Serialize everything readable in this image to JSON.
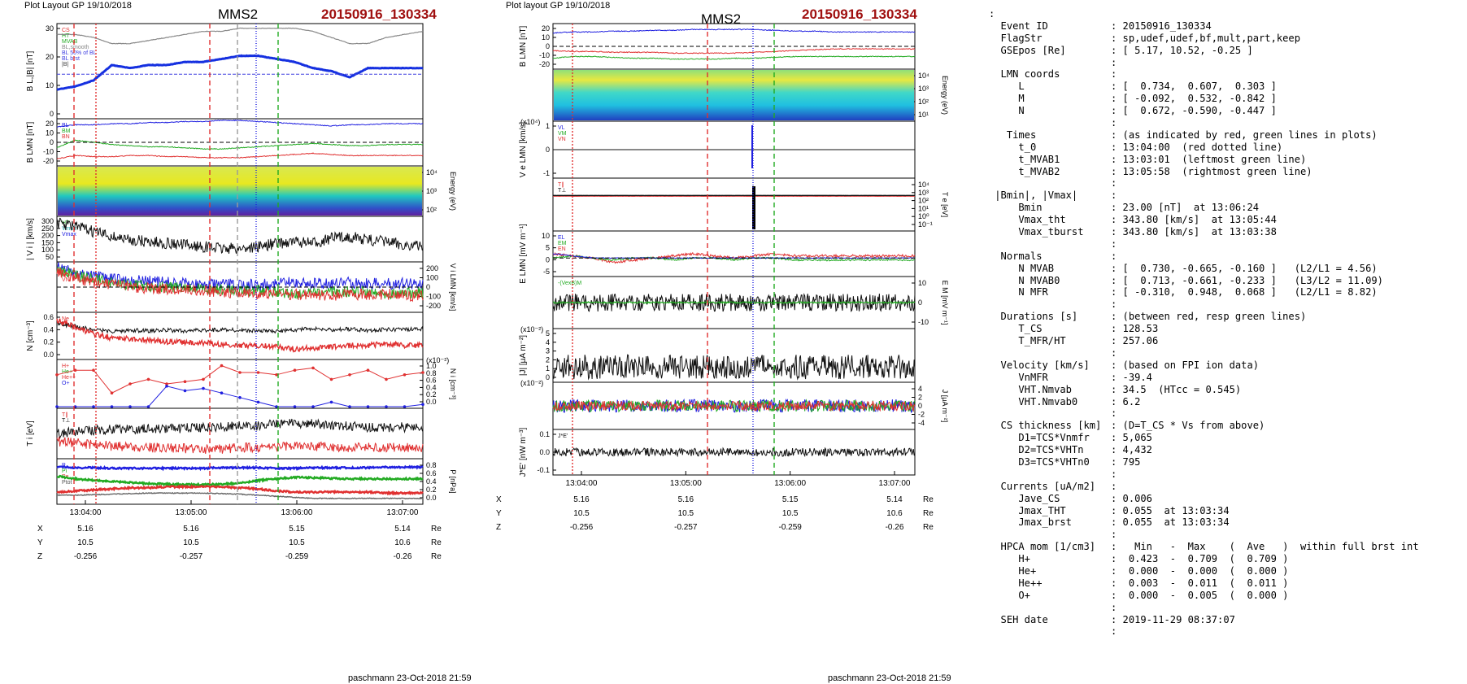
{
  "left": {
    "layout_label": "Plot Layout GP 19/10/2018",
    "title": "MMS2",
    "event": "20150916_130334",
    "footer": "paschmann 23-Oct-2018 21:59",
    "time_ticks": [
      "13:04:00",
      "13:05:00",
      "13:06:00",
      "13:07:00"
    ],
    "pos_rows": [
      {
        "label": "X",
        "vals": [
          "5.16",
          "5.16",
          "5.15",
          "5.14"
        ],
        "unit": "Re"
      },
      {
        "label": "Y",
        "vals": [
          "10.5",
          "10.5",
          "10.5",
          "10.6"
        ],
        "unit": "Re"
      },
      {
        "label": "Z",
        "vals": [
          "-0.256",
          "-0.257",
          "-0.259",
          "-0.26"
        ],
        "unit": "Re"
      }
    ],
    "panels": [
      {
        "ylabel": "B",
        "ylabel_sub": "L",
        "ylabel_rest": ",|B| [nT]",
        "yticks": [
          "30",
          "20",
          "10",
          "0"
        ],
        "legend": [
          "CS",
          "HT",
          "MVAB",
          "BL,smooth",
          "BL 50% of BL",
          "BL brst",
          "|B|"
        ],
        "legend_colors": [
          "#e03030",
          "#22aa22",
          "#22aa22",
          "#888888",
          "#4040e0",
          "#4040e0",
          "#444444"
        ]
      },
      {
        "ylabel": "B",
        "ylabel_sub": "LMN",
        "ylabel_rest": " [nT]",
        "yticks": [
          "20",
          "10",
          "0",
          "-10",
          "-20"
        ],
        "legend": [
          "BL",
          "BM",
          "BN"
        ],
        "legend_colors": [
          "#2020e0",
          "#22aa22",
          "#e03030"
        ]
      },
      {
        "ylabel": "",
        "ylabel_sub": "",
        "ylabel_rest": "",
        "yticks_right": [
          "10⁴",
          "10³",
          "10²"
        ],
        "right_label": "Energy (eV)"
      },
      {
        "ylabel": "| V",
        "ylabel_sub": "i",
        "ylabel_rest": " | [km/s]",
        "yticks": [
          "300",
          "250",
          "200",
          "150",
          "100",
          "50"
        ],
        "legend": [
          "HT",
          "Vmax",
          "Vmax"
        ],
        "legend_colors": [
          "#22aa22",
          "#22aaaa",
          "#2020e0"
        ]
      },
      {
        "ylabel": "",
        "yticks_right": [
          "200",
          "100",
          "0",
          "-100",
          "-200"
        ],
        "right_label": "V i LMN [km/s]",
        "legend": [
          "VL",
          "VM",
          "VN"
        ],
        "legend_colors": [
          "#2020e0",
          "#22aa22",
          "#e03030"
        ]
      },
      {
        "ylabel": "N [cm",
        "ylabel_sub": "",
        "ylabel_rest": "⁻³]",
        "yticks": [
          "0.6",
          "0.4",
          "0.2",
          "0.0"
        ],
        "legend": [
          "Ne",
          "Ni"
        ],
        "legend_colors": [
          "#e03030",
          "#111111"
        ]
      },
      {
        "ylabel": "",
        "yticks_right": [
          "1.0",
          "0.8",
          "0.6",
          "0.4",
          "0.2",
          "0.0"
        ],
        "right_label": "N i [cm⁻³]",
        "exp": "(x10⁻²)",
        "legend": [
          "H+",
          "He+",
          "He++",
          "O+"
        ],
        "legend_colors": [
          "#e03030",
          "#22aa22",
          "#e03030",
          "#2020e0"
        ]
      },
      {
        "ylabel": "T",
        "ylabel_sub": "i",
        "ylabel_rest": " [eV]",
        "yticks": [],
        "legend": [
          "T∥",
          "T⊥"
        ],
        "legend_colors": [
          "#e03030",
          "#111111"
        ]
      },
      {
        "ylabel": "",
        "yticks_right": [
          "0.8",
          "0.6",
          "0.4",
          "0.2",
          "0.0"
        ],
        "right_label": "P [nPa]",
        "legend": [
          "P",
          "Pi",
          "Pe",
          "Ptot"
        ],
        "legend_colors": [
          "#2020e0",
          "#22aa22",
          "#e03030",
          "#555555"
        ]
      }
    ]
  },
  "right": {
    "layout_label": "Plot layout GP 19/10/2018",
    "title": "MMS2",
    "event": "20150916_130334",
    "footer": "paschmann 23-Oct-2018 21:59",
    "time_ticks": [
      "13:04:00",
      "13:05:00",
      "13:06:00",
      "13:07:00"
    ],
    "pos_rows": [
      {
        "label": "X",
        "vals": [
          "5.16",
          "5.16",
          "5.15",
          "5.14"
        ],
        "unit": "Re"
      },
      {
        "label": "Y",
        "vals": [
          "10.5",
          "10.5",
          "10.5",
          "10.6"
        ],
        "unit": "Re"
      },
      {
        "label": "Z",
        "vals": [
          "-0.256",
          "-0.257",
          "-0.259",
          "-0.26"
        ],
        "unit": "Re"
      }
    ],
    "panels": [
      {
        "ylabel": "B LMN [nT]",
        "yticks": [
          "20",
          "10",
          "0",
          "-10",
          "-20"
        ]
      },
      {
        "ylabel": "",
        "right_label": "Energy (eV)",
        "yticks_right": [
          "10⁴",
          "10³",
          "10²",
          "10¹"
        ]
      },
      {
        "ylabel": "V e LMN [km/s]",
        "exp": "(x10⁴)",
        "yticks": [
          "1",
          "0",
          "-1"
        ],
        "legend": [
          "VL",
          "VM",
          "VN"
        ],
        "legend_colors": [
          "#2020e0",
          "#22aa22",
          "#e03030"
        ]
      },
      {
        "ylabel": "",
        "right_label": "T e [eV]",
        "yticks_right": [
          "10⁴",
          "10³",
          "10²",
          "10¹",
          "10⁰",
          "10⁻¹"
        ],
        "legend": [
          "T∥",
          "T⊥"
        ],
        "legend_colors": [
          "#e03030",
          "#111111"
        ]
      },
      {
        "ylabel": "E LMN [mV m⁻¹]",
        "yticks": [
          "10",
          "5",
          "0",
          "-5"
        ],
        "legend": [
          "EL",
          "EM",
          "EN"
        ],
        "legend_colors": [
          "#2020e0",
          "#22aa22",
          "#e03030"
        ]
      },
      {
        "ylabel": "",
        "right_label": "E M [mV m⁻¹]",
        "yticks_right": [
          "10",
          "0",
          "-10"
        ],
        "legend": [
          "-(VexB)M"
        ],
        "legend_colors": [
          "#22aa22"
        ]
      },
      {
        "ylabel": "|J| [μA m⁻²]",
        "exp": "(x10⁻²)",
        "yticks": [
          "5",
          "4",
          "3",
          "2",
          "1",
          "0"
        ]
      },
      {
        "ylabel": "",
        "right_label": "J [μA m⁻²]",
        "exp": "(x10⁻²)",
        "yticks_right": [
          "4",
          "2",
          "0",
          "-2",
          "-4"
        ]
      },
      {
        "ylabel": "J*E' [nW m⁻³]",
        "yticks": [
          "0.1",
          "0.0",
          "-0.1"
        ],
        "legend": [
          "J*E'"
        ],
        "legend_colors": [
          "#111111"
        ]
      }
    ]
  },
  "summary": [
    {
      "k": ":",
      "v": ""
    },
    {
      "k": "  Event ID",
      "v": ": 20150916_130334"
    },
    {
      "k": "  FlagStr",
      "v": ": sp,udef,udef,bf,mult,part,keep"
    },
    {
      "k": "  GSEpos [Re]",
      "v": ": [ 5.17, 10.52, -0.25 ]"
    },
    {
      "k": "",
      "v": ":"
    },
    {
      "k": "  LMN coords",
      "v": ":"
    },
    {
      "k": "     L",
      "v": ": [  0.734,  0.607,  0.303 ]"
    },
    {
      "k": "     M",
      "v": ": [ -0.092,  0.532, -0.842 ]"
    },
    {
      "k": "     N",
      "v": ": [  0.672, -0.590, -0.447 ]"
    },
    {
      "k": "",
      "v": ":"
    },
    {
      "k": "   Times",
      "v": ": (as indicated by red, green lines in plots)"
    },
    {
      "k": "     t_0",
      "v": ": 13:04:00  (red dotted line)"
    },
    {
      "k": "     t_MVAB1",
      "v": ": 13:03:01  (leftmost green line)"
    },
    {
      "k": "     t_MVAB2",
      "v": ": 13:05:58  (rightmost green line)"
    },
    {
      "k": "",
      "v": ":"
    },
    {
      "k": " |Bmin|, |Vmax|",
      "v": ":"
    },
    {
      "k": "     Bmin",
      "v": ": 23.00 [nT]  at 13:06:24"
    },
    {
      "k": "     Vmax_tht",
      "v": ": 343.80 [km/s]  at 13:05:44"
    },
    {
      "k": "     Vmax_tburst",
      "v": ": 343.80 [km/s]  at 13:03:38"
    },
    {
      "k": "",
      "v": ":"
    },
    {
      "k": "  Normals",
      "v": ":"
    },
    {
      "k": "     N MVAB",
      "v": ": [  0.730, -0.665, -0.160 ]   (L2/L1 = 4.56)"
    },
    {
      "k": "     N MVAB0",
      "v": ": [  0.713, -0.661, -0.233 ]   (L3/L2 = 11.09)"
    },
    {
      "k": "     N MFR",
      "v": ": [ -0.310,  0.948,  0.068 ]   (L2/L1 = 8.82)"
    },
    {
      "k": "",
      "v": ":"
    },
    {
      "k": "  Durations [s]",
      "v": ": (between red, resp green lines)"
    },
    {
      "k": "     T_CS",
      "v": ": 128.53"
    },
    {
      "k": "     T_MFR/HT",
      "v": ": 257.06"
    },
    {
      "k": "",
      "v": ":"
    },
    {
      "k": "  Velocity [km/s]",
      "v": ": (based on FPI ion data)"
    },
    {
      "k": "     VnMFR",
      "v": ": -39.4"
    },
    {
      "k": "     VHT.Nmvab",
      "v": ": 34.5  (HTcc = 0.545)"
    },
    {
      "k": "     VHT.Nmvab0",
      "v": ": 6.2"
    },
    {
      "k": "",
      "v": ":"
    },
    {
      "k": "  CS thickness [km]",
      "v": ": (D=T_CS * Vs from above)"
    },
    {
      "k": "     D1=TCS*Vnmfr",
      "v": ": 5,065"
    },
    {
      "k": "     D2=TCS*VHTn",
      "v": ": 4,432"
    },
    {
      "k": "     D3=TCS*VHTn0",
      "v": ": 795"
    },
    {
      "k": "",
      "v": ":"
    },
    {
      "k": "  Currents [uA/m2]",
      "v": ":"
    },
    {
      "k": "     Jave_CS",
      "v": ": 0.006"
    },
    {
      "k": "     Jmax_THT",
      "v": ": 0.055  at 13:03:34"
    },
    {
      "k": "     Jmax_brst",
      "v": ": 0.055  at 13:03:34"
    },
    {
      "k": "",
      "v": ":"
    },
    {
      "k": "  HPCA mom [1/cm3]",
      "v": ":   Min   -  Max    (  Ave   )  within full brst int"
    },
    {
      "k": "     H+",
      "v": ":  0.423  -  0.709  (  0.709 )"
    },
    {
      "k": "     He+",
      "v": ":  0.000  -  0.000  (  0.000 )"
    },
    {
      "k": "     He++",
      "v": ":  0.003  -  0.011  (  0.011 )"
    },
    {
      "k": "     O+",
      "v": ":  0.000  -  0.005  (  0.000 )"
    },
    {
      "k": "",
      "v": ":"
    },
    {
      "k": "  SEH date",
      "v": ": 2019-11-29 08:37:07"
    },
    {
      "k": "",
      "v": ":"
    }
  ],
  "chart_data": [
    {
      "type": "line",
      "title": "MMS2 20150916_130334",
      "xlabel": "",
      "x_ticks": [
        "13:04:00",
        "13:05:00",
        "13:06:00",
        "13:07:00"
      ],
      "x_minutes": [
        0,
        1,
        2,
        3
      ],
      "xlim_minutes": [
        -0.5,
        3.1
      ],
      "marker_lines_minutes": {
        "red": [
          -0.35,
          1.12
        ],
        "green": [
          2.05
        ],
        "gray": [
          1.65
        ],
        "blue_dotted": [
          1.95
        ]
      },
      "panels": [
        {
          "id": "BL_B",
          "ylim": [
            0,
            30
          ],
          "series": [
            {
              "name": "BL brst",
              "values": [
                9,
                10,
                12,
                17,
                16,
                17,
                17,
                18,
                18,
                19,
                20,
                20,
                19,
                18,
                16,
                15,
                13,
                16,
                16,
                16,
                16
              ]
            },
            {
              "name": "|B|",
              "values": [
                27,
                27,
                26,
                24,
                24,
                25,
                26,
                27,
                28,
                28,
                29,
                29,
                29,
                29,
                28,
                26,
                24,
                24,
                26,
                27,
                28
              ]
            }
          ]
        },
        {
          "id": "BLMN",
          "ylim": [
            -20,
            20
          ],
          "series": [
            {
              "name": "BL",
              "values": [
                14,
                16,
                16,
                17,
                17,
                18,
                18,
                19,
                19,
                20,
                20,
                19,
                18,
                17,
                16,
                15,
                16,
                16,
                17,
                17,
                17
              ]
            },
            {
              "name": "BM",
              "values": [
                -5,
                2,
                0,
                -2,
                -3,
                -4,
                -4,
                -5,
                -6,
                -6,
                -5,
                -4,
                -3,
                -2,
                -1,
                -2,
                -3,
                -3,
                -2,
                -2,
                -2
              ]
            },
            {
              "name": "BN",
              "values": [
                -15,
                -12,
                -13,
                -13,
                -12,
                -12,
                -13,
                -13,
                -14,
                -14,
                -14,
                -13,
                -12,
                -11,
                -10,
                -11,
                -12,
                -12,
                -12,
                -12,
                -12
              ]
            }
          ]
        },
        {
          "id": "Vi",
          "ylim": [
            50,
            300
          ],
          "series": [
            {
              "name": "|Vi|",
              "values": [
                270,
                250,
                220,
                190,
                170,
                160,
                150,
                140,
                130,
                120,
                120,
                130,
                150,
                160,
                150,
                180,
                190,
                170,
                160,
                140,
                130
              ]
            }
          ]
        },
        {
          "id": "N",
          "ylim": [
            0,
            0.6
          ],
          "series": [
            {
              "name": "Ni",
              "values": [
                0.55,
                0.5,
                0.45,
                0.42,
                0.44,
                0.43,
                0.44,
                0.43,
                0.44,
                0.45,
                0.44,
                0.43,
                0.42,
                0.45,
                0.46,
                0.45,
                0.46,
                0.44,
                0.45,
                0.45,
                0.46
              ]
            },
            {
              "name": "Ne",
              "values": [
                0.6,
                0.5,
                0.38,
                0.32,
                0.3,
                0.28,
                0.26,
                0.25,
                0.24,
                0.22,
                0.2,
                0.2,
                0.18,
                0.14,
                0.16,
                0.18,
                0.2,
                0.2,
                0.22,
                0.2,
                0.2
              ]
            }
          ]
        },
        {
          "id": "Ni_HPCA",
          "ylim": [
            0,
            1.0
          ],
          "series": [
            {
              "name": "H+",
              "values": [
                0.7,
                0.8,
                0.8,
                0.3,
                0.5,
                0.6,
                0.5,
                0.55,
                0.6,
                0.9,
                0.75,
                0.75,
                0.7,
                0.8,
                0.85,
                0.6,
                0.7,
                0.8,
                0.6,
                0.7,
                0.75
              ]
            },
            {
              "name": "O+",
              "values": [
                0.0,
                0.0,
                0.0,
                0.0,
                0.0,
                0.0,
                0.45,
                0.35,
                0.4,
                0.3,
                0.2,
                0.1,
                0.0,
                0.0,
                0.0,
                0.1,
                0.0,
                0.0,
                0.0,
                0.0,
                0.05
              ]
            }
          ]
        }
      ]
    }
  ]
}
